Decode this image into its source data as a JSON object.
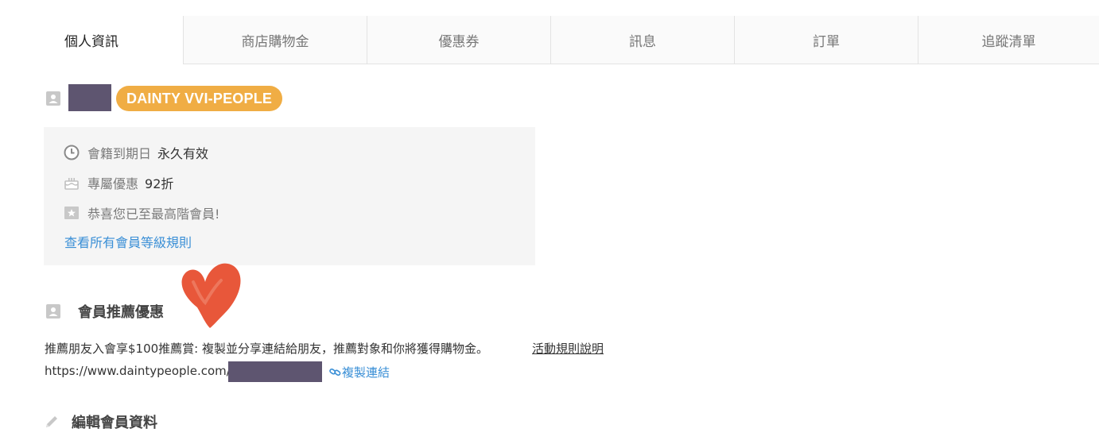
{
  "tabs": [
    {
      "label": "個人資訊",
      "active": true
    },
    {
      "label": "商店購物金"
    },
    {
      "label": "優惠券"
    },
    {
      "label": "訊息"
    },
    {
      "label": "訂單"
    },
    {
      "label": "追蹤清單"
    }
  ],
  "profile": {
    "tier_badge": "DAINTY VVI-PEOPLE",
    "icon": "contact-card-icon"
  },
  "membership": {
    "expiry_label": "會籍到期日",
    "expiry_value": "永久有效",
    "discount_label": "專屬優惠",
    "discount_value": "92折",
    "top_tier_message": "恭喜您已至最高階會員!",
    "rules_link": "查看所有會員等級規則"
  },
  "referral": {
    "title": "會員推薦優惠",
    "description": "推薦朋友入會享$100推薦賞: 複製並分享連結給朋友，推薦對象和你將獲得購物金。",
    "activity_rules_link": "活動規則說明",
    "url_prefix": "https://www.daintypeople.com/",
    "copy_link_label": "複製連結"
  },
  "edit_profile": {
    "title": "編輯會員資料"
  },
  "colors": {
    "badge": "#f0ad44",
    "link": "#3a8fd6",
    "info_bg": "#f5f5f5",
    "heart": "#e8573a",
    "mask": "#5e5570"
  }
}
